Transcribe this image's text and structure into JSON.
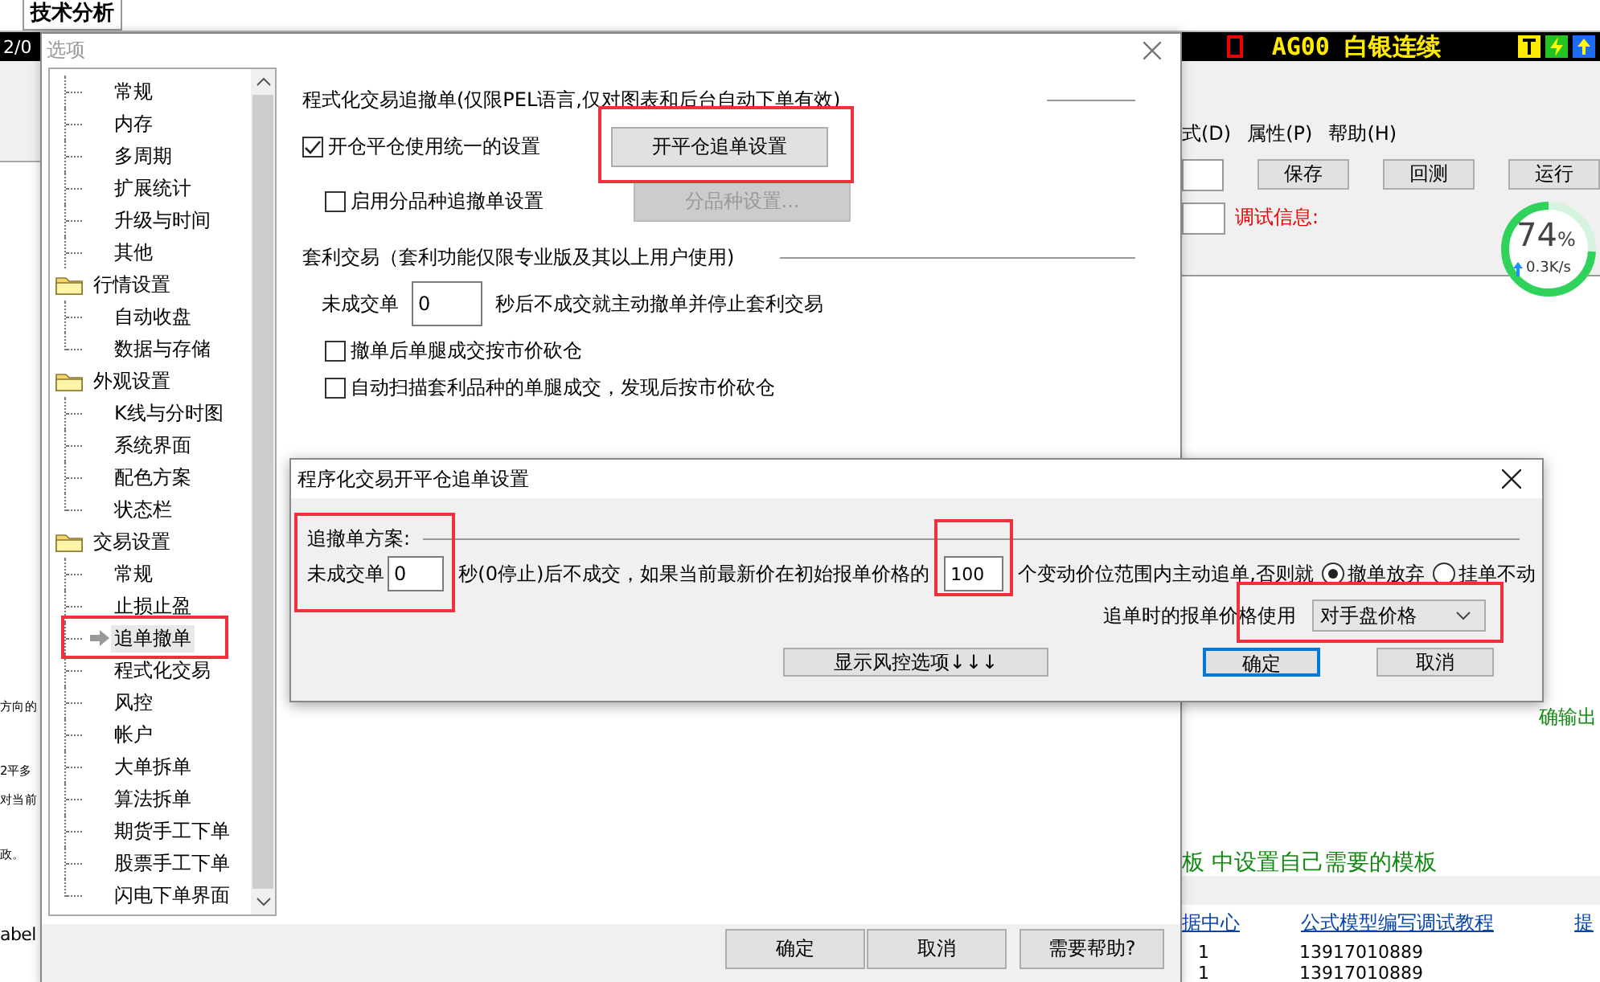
{
  "app": {
    "tab": "技术分析",
    "bar_text": "2/0",
    "symbol": "AG00 白银连续",
    "left_fragments": [
      "方向的",
      "2平多",
      "对当前",
      "政。",
      "abel"
    ],
    "menu": [
      "式(D)",
      "属性(P)",
      "帮助(H)"
    ],
    "toolbar_buttons": [
      "保存",
      "回测",
      "运行"
    ],
    "debug_label": "调试信息:",
    "meter": {
      "value": "74",
      "unit": "%",
      "speed": "0.3K/s",
      "level": 0.74
    },
    "messages": [
      "确输出",
      "板  中设置自己需要的模板"
    ],
    "links": [
      "据中心",
      "公式模型编写调试教程",
      "提"
    ],
    "table_rows": [
      [
        "1",
        "13917010889"
      ],
      [
        "1",
        "13917010889"
      ]
    ]
  },
  "options": {
    "title": "选项",
    "tree": [
      {
        "kind": "item",
        "label": "常规",
        "selected": false
      },
      {
        "kind": "item",
        "label": "内存",
        "selected": false
      },
      {
        "kind": "item",
        "label": "多周期",
        "selected": false
      },
      {
        "kind": "item",
        "label": "扩展统计",
        "selected": false
      },
      {
        "kind": "item",
        "label": "升级与时间",
        "selected": false
      },
      {
        "kind": "item",
        "label": "其他",
        "selected": false
      },
      {
        "kind": "folder",
        "label": "行情设置",
        "children": [
          {
            "label": "自动收盘",
            "selected": false
          },
          {
            "label": "数据与存储",
            "selected": false
          }
        ]
      },
      {
        "kind": "folder",
        "label": "外观设置",
        "children": [
          {
            "label": "K线与分时图",
            "selected": false
          },
          {
            "label": "系统界面",
            "selected": false
          },
          {
            "label": "配色方案",
            "selected": false
          },
          {
            "label": "状态栏",
            "selected": false
          }
        ]
      },
      {
        "kind": "folder",
        "label": "交易设置",
        "children": [
          {
            "label": "常规",
            "selected": false
          },
          {
            "label": "止损止盈",
            "selected": false
          },
          {
            "label": "追单撤单",
            "selected": true
          },
          {
            "label": "程式化交易",
            "selected": false
          },
          {
            "label": "风控",
            "selected": false
          },
          {
            "label": "帐户",
            "selected": false
          },
          {
            "label": "大单拆单",
            "selected": false
          },
          {
            "label": "算法拆单",
            "selected": false
          },
          {
            "label": "期货手工下单",
            "selected": false
          },
          {
            "label": "股票手工下单",
            "selected": false
          },
          {
            "label": "闪电下单界面",
            "selected": false
          }
        ]
      }
    ],
    "auto_section": {
      "title": "程式化交易追撤单(仅限PEL语言,仅对图表和后台自动下单有效)",
      "rows": [
        {
          "checkbox": {
            "label": "开仓平仓使用统一的设置",
            "checked": true
          },
          "button": {
            "label": "开平仓追单设置",
            "disabled": false
          }
        },
        {
          "checkbox": {
            "label": "启用分品种追撤单设置",
            "checked": false
          },
          "button": {
            "label": "分品种设置...",
            "disabled": true
          }
        }
      ]
    },
    "arb_section": {
      "title": "套利交易（套利功能仅限专业版及其以上用户使用)",
      "timeout": {
        "label": "未成交单",
        "value": "0",
        "suffix": "秒后不成交就主动撤单并停止套利交易"
      },
      "checkboxes": [
        {
          "label": "撤单后单腿成交按市价砍仓",
          "checked": false
        },
        {
          "label": "自动扫描套利品种的单腿成交，发现后按市价砍仓",
          "checked": false
        }
      ]
    },
    "buttons": [
      "确定",
      "取消",
      "需要帮助?"
    ]
  },
  "sub_dialog": {
    "title": "程序化交易开平仓追单设置",
    "group": "追撤单方案:",
    "timeout_label": "未成交单",
    "timeout_value": "0",
    "middle_text": "秒(0停止)后不成交，如果当前最新价在初始报单价格的",
    "ticks_value": "100",
    "after_text": "个变动价位范围内主动追单,否则就",
    "options": [
      {
        "label": "撤单放弃",
        "selected": true
      },
      {
        "label": "挂单不动",
        "selected": false
      }
    ],
    "price_label": "追单时的报单价格使用",
    "price_value": "对手盘价格",
    "risk_button": "显示风控选项↓↓↓",
    "buttons": [
      {
        "label": "确定",
        "default": true
      },
      {
        "label": "取消",
        "default": false
      }
    ]
  }
}
